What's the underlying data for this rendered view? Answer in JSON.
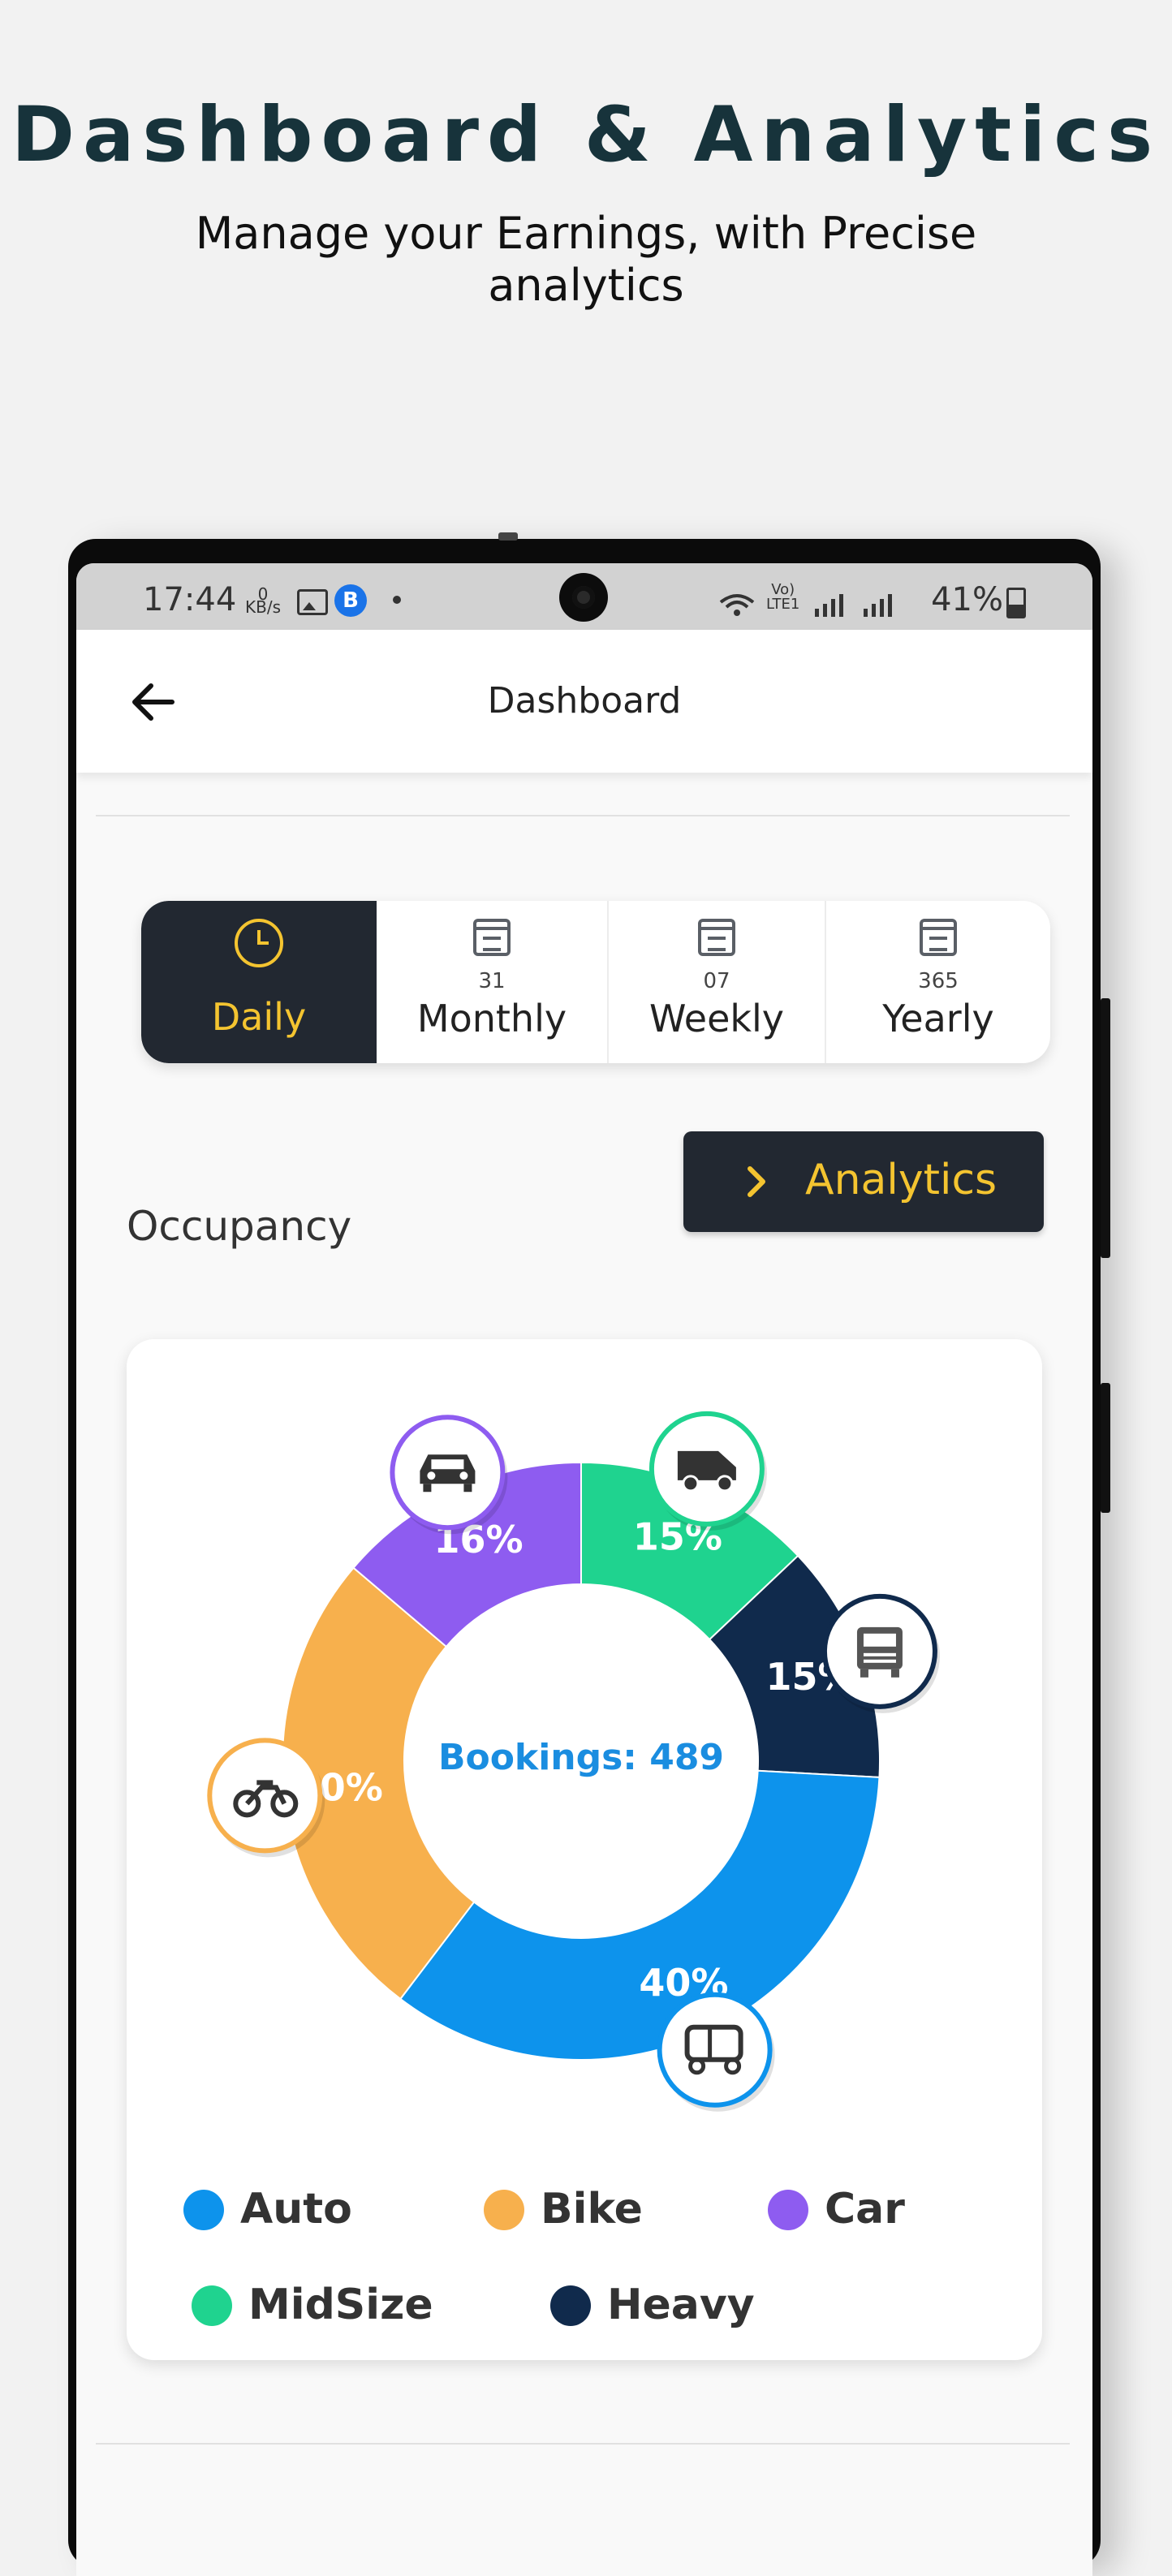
{
  "promo": {
    "title": "Dashboard & Analytics",
    "subtitle": "Manage your Earnings, with Precise analytics"
  },
  "status_bar": {
    "time": "17:44",
    "data_rate": "0\nKB/s",
    "app_badge": "B",
    "network_label": "Vo)\nLTE1",
    "battery": "41%"
  },
  "app_bar": {
    "title": "Dashboard",
    "back_icon": "back-arrow-icon"
  },
  "period_tabs": [
    {
      "label": "Daily",
      "number": "",
      "icon": "clock-icon",
      "selected": true
    },
    {
      "label": "Monthly",
      "number": "31",
      "icon": "calendar-icon",
      "selected": false
    },
    {
      "label": "Weekly",
      "number": "07",
      "icon": "calendar-icon",
      "selected": false
    },
    {
      "label": "Yearly",
      "number": "365",
      "icon": "calendar-icon",
      "selected": false
    }
  ],
  "analytics_button": {
    "label": "Analytics",
    "icon": "chevron-right-icon"
  },
  "section": {
    "occupancy_label": "Occupancy"
  },
  "colors": {
    "accent": "#f4c430",
    "dark": "#222831",
    "auto": "#0d93ec",
    "bike": "#f7b04d",
    "car": "#8e5cf0",
    "midsize": "#1fd38f",
    "heavy": "#102a4c"
  },
  "chart_data": {
    "type": "pie",
    "center_text": "Bookings: 489",
    "series": [
      {
        "name": "Auto",
        "value": 40,
        "label": "40%",
        "color": "#0d93ec",
        "icon": "auto-rickshaw-icon"
      },
      {
        "name": "Bike",
        "value": 30,
        "label": "30%",
        "color": "#f7b04d",
        "icon": "motorbike-icon"
      },
      {
        "name": "Car",
        "value": 16,
        "label": "16%",
        "color": "#8e5cf0",
        "icon": "car-icon"
      },
      {
        "name": "MidSize",
        "value": 15,
        "label": "15%",
        "color": "#1fd38f",
        "icon": "van-icon"
      },
      {
        "name": "Heavy",
        "value": 15,
        "label": "15%",
        "color": "#102a4c",
        "icon": "truck-icon"
      }
    ],
    "legend": [
      "Auto",
      "Bike",
      "Car",
      "MidSize",
      "Heavy"
    ]
  }
}
